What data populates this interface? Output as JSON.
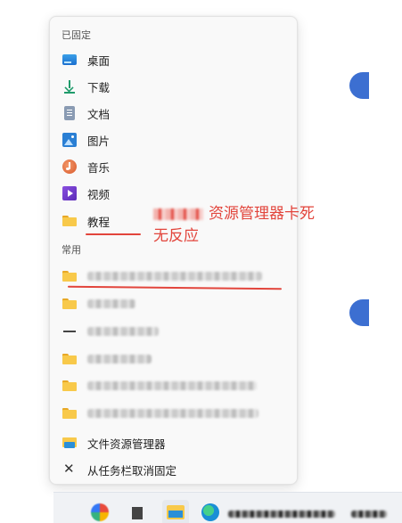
{
  "jumplist": {
    "pinned_title": "已固定",
    "pinned": [
      {
        "label": "桌面",
        "icon": "desktop-icon"
      },
      {
        "label": "下载",
        "icon": "download-icon"
      },
      {
        "label": "文档",
        "icon": "documents-icon"
      },
      {
        "label": "图片",
        "icon": "pictures-icon"
      },
      {
        "label": "音乐",
        "icon": "music-icon"
      },
      {
        "label": "视频",
        "icon": "videos-icon"
      },
      {
        "label": "教程",
        "icon": "folder-icon"
      }
    ],
    "frequent_title": "常用",
    "frequent_icons": [
      "folder-icon",
      "folder-icon",
      "dash-icon",
      "folder-icon",
      "folder-icon",
      "folder-icon"
    ],
    "actions": [
      {
        "label": "文件资源管理器",
        "icon": "file-explorer-icon"
      },
      {
        "label": "从任务栏取消固定",
        "icon": "unpin-icon"
      }
    ]
  },
  "annotation": {
    "line1": "资源管理器卡死",
    "line2": "无反应",
    "color": "#e2453c"
  },
  "colors": {
    "accent": "#3c6fd1",
    "folder": "#f8c94a",
    "annotation_red": "#e2453c"
  }
}
